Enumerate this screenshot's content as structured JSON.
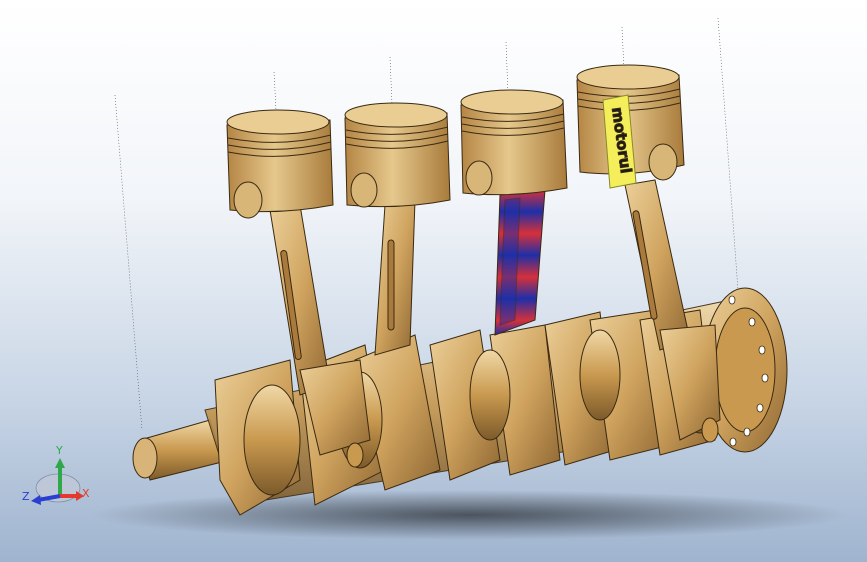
{
  "viewport": {
    "background_top": "#ffffff",
    "background_bottom": "#9fb4cf"
  },
  "colors": {
    "part_light": "#e2bd80",
    "part_mid": "#c89a57",
    "part_dark": "#8a6430",
    "edge": "#3a2a12",
    "stress_red": "#d6303a",
    "stress_blue": "#1e2fa8",
    "highlight_yellow": "#f3ee5a",
    "shadow": "#4a4a4a"
  },
  "part_label": {
    "text": "motorul"
  },
  "triad": {
    "x_label": "X",
    "y_label": "Y",
    "z_label": "Z",
    "x_color": "#e23b2e",
    "y_color": "#2fa84a",
    "z_color": "#2a3fcf"
  }
}
